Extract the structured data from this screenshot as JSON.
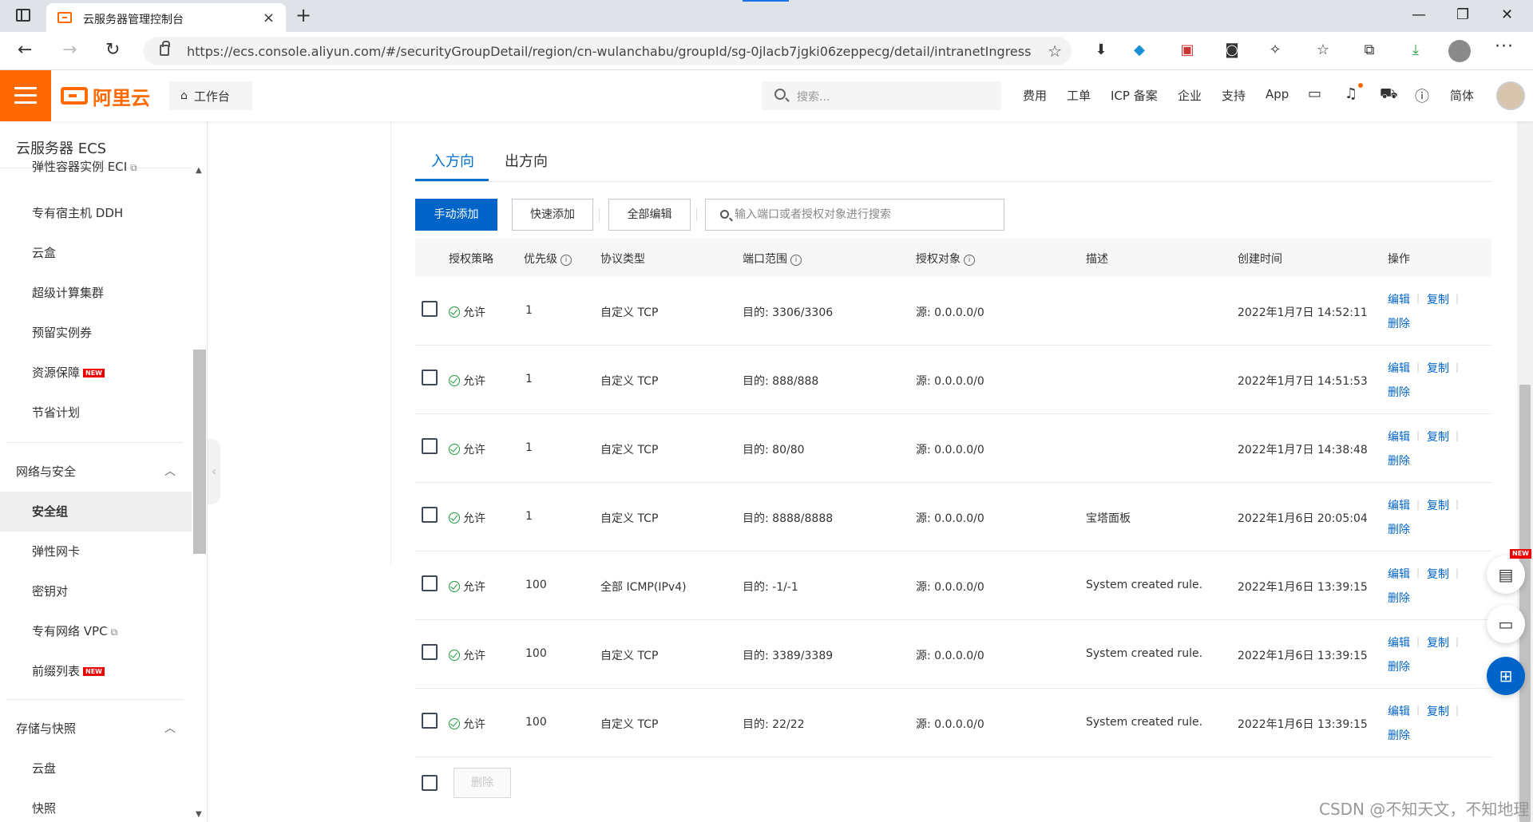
{
  "browser": {
    "tab_title": "云服务器管理控制台",
    "tab_close": "×",
    "new_tab": "+",
    "url": "https://ecs.console.aliyun.com/#/securityGroupDetail/region/cn-wulanchabu/groupId/sg-0jlacb7jgki06zeppecg/detail/intranetIngress",
    "window_controls": [
      "—",
      "❐",
      "✕"
    ],
    "more": "···"
  },
  "header": {
    "logo_text": "阿里云",
    "workbench": "工作台",
    "search_placeholder": "搜索...",
    "links": [
      "费用",
      "工单",
      "ICP 备案",
      "企业",
      "支持",
      "App"
    ],
    "lang": "简体"
  },
  "sidebar": {
    "title": "云服务器 ECS",
    "items_top": [
      {
        "label": "弹性容器实例 ECI",
        "external": true
      },
      {
        "label": "专有宿主机 DDH"
      },
      {
        "label": "云盒"
      },
      {
        "label": "超级计算集群"
      },
      {
        "label": "预留实例券"
      },
      {
        "label": "资源保障",
        "badge": "NEW"
      },
      {
        "label": "节省计划"
      }
    ],
    "group_network": "网络与安全",
    "items_network": [
      {
        "label": "安全组",
        "active": true
      },
      {
        "label": "弹性网卡"
      },
      {
        "label": "密钥对"
      },
      {
        "label": "专有网络 VPC",
        "external": true
      },
      {
        "label": "前缀列表",
        "badge": "NEW"
      }
    ],
    "group_storage": "存储与快照",
    "items_storage": [
      {
        "label": "云盘"
      },
      {
        "label": "快照"
      }
    ]
  },
  "main": {
    "tabs": [
      "入方向",
      "出方向"
    ],
    "buttons": {
      "manual_add": "手动添加",
      "quick_add": "快速添加",
      "edit_all": "全部编辑"
    },
    "search_placeholder": "输入端口或者授权对象进行搜索",
    "columns": [
      "授权策略",
      "优先级",
      "协议类型",
      "端口范围",
      "授权对象",
      "描述",
      "创建时间",
      "操作"
    ],
    "info_icon": "i",
    "actions": {
      "edit": "编辑",
      "copy": "复制",
      "delete": "删除"
    },
    "rows": [
      {
        "policy": "允许",
        "priority": "1",
        "protocol": "自定义 TCP",
        "port": "目的: 3306/3306",
        "source": "源: 0.0.0.0/0",
        "desc": "",
        "created": "2022年1月7日 14:52:11"
      },
      {
        "policy": "允许",
        "priority": "1",
        "protocol": "自定义 TCP",
        "port": "目的: 888/888",
        "source": "源: 0.0.0.0/0",
        "desc": "",
        "created": "2022年1月7日 14:51:53"
      },
      {
        "policy": "允许",
        "priority": "1",
        "protocol": "自定义 TCP",
        "port": "目的: 80/80",
        "source": "源: 0.0.0.0/0",
        "desc": "",
        "created": "2022年1月7日 14:38:48"
      },
      {
        "policy": "允许",
        "priority": "1",
        "protocol": "自定义 TCP",
        "port": "目的: 8888/8888",
        "source": "源: 0.0.0.0/0",
        "desc": "宝塔面板",
        "created": "2022年1月6日 20:05:04"
      },
      {
        "policy": "允许",
        "priority": "100",
        "protocol": "全部 ICMP(IPv4)",
        "port": "目的: -1/-1",
        "source": "源: 0.0.0.0/0",
        "desc": "System created rule.",
        "created": "2022年1月6日 13:39:15"
      },
      {
        "policy": "允许",
        "priority": "100",
        "protocol": "自定义 TCP",
        "port": "目的: 3389/3389",
        "source": "源: 0.0.0.0/0",
        "desc": "System created rule.",
        "created": "2022年1月6日 13:39:15"
      },
      {
        "policy": "允许",
        "priority": "100",
        "protocol": "自定义 TCP",
        "port": "目的: 22/22",
        "source": "源: 0.0.0.0/0",
        "desc": "System created rule.",
        "created": "2022年1月6日 13:39:15"
      }
    ],
    "footer_delete": "删除"
  },
  "floating": {
    "new_badge": "NEW"
  },
  "watermark": "CSDN @不知天文，不知地理"
}
